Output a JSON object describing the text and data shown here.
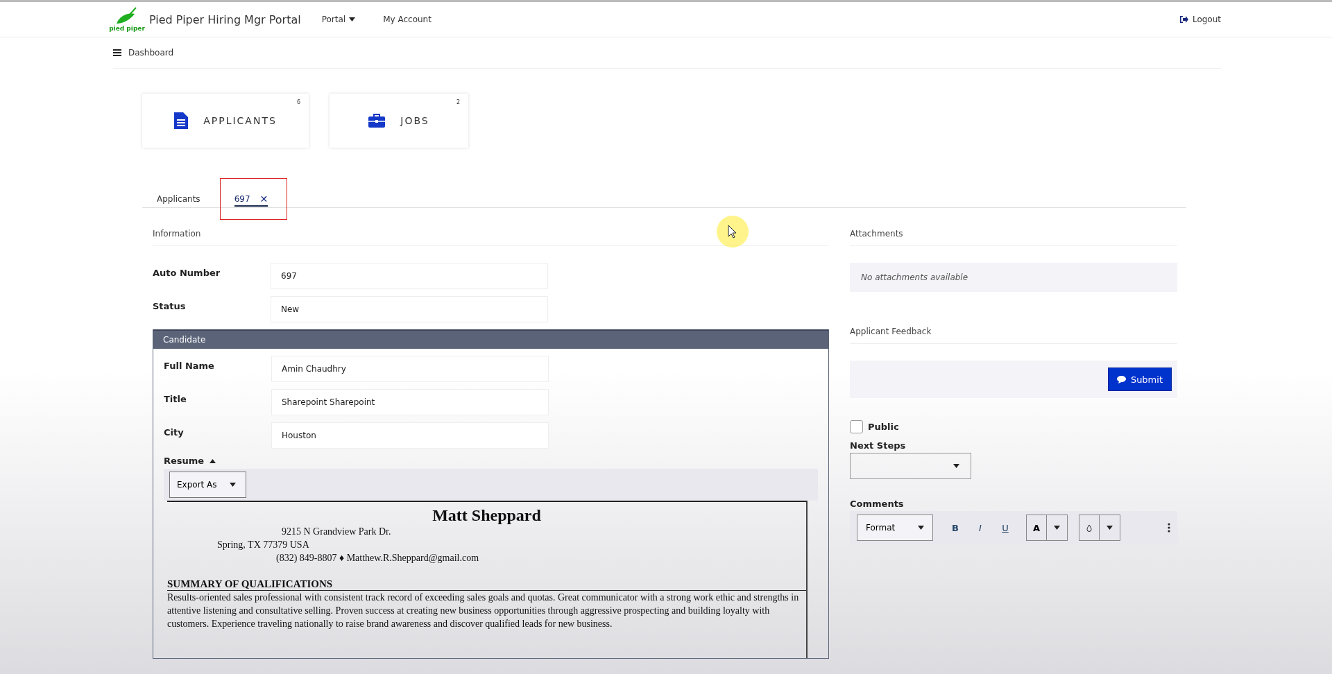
{
  "header": {
    "title": "Pied Piper Hiring Mgr Portal",
    "logo_caption": "pied piper",
    "nav": [
      {
        "label": "Portal",
        "dropdown": true
      },
      {
        "label": "My Account",
        "dropdown": false
      }
    ],
    "logout": "Logout"
  },
  "breadcrumb": "Dashboard",
  "tiles": [
    {
      "label": "APPLICANTS",
      "count": "6",
      "kind": "document"
    },
    {
      "label": "JOBS",
      "count": "2",
      "kind": "briefcase"
    }
  ],
  "tabs": [
    {
      "label": "Applicants",
      "selected": false,
      "highlighted": false
    },
    {
      "label": "697",
      "selected": true,
      "close": "✕",
      "highlighted": true
    }
  ],
  "information": {
    "heading": "Information",
    "fields": [
      {
        "label": "Auto Number",
        "value": "697"
      },
      {
        "label": "Status",
        "value": "New"
      }
    ]
  },
  "candidate": {
    "heading": "Candidate",
    "fields": [
      {
        "label": "Full Name",
        "value": "Amin Chaudhry"
      },
      {
        "label": "Title",
        "value": "Sharepoint Sharepoint"
      },
      {
        "label": "City",
        "value": "Houston"
      }
    ],
    "resume": {
      "label": "Resume",
      "expanded": true,
      "export": "Export As",
      "name": "Matt Sheppard",
      "address_lines": [
        "9215 N Grandview Park Dr.",
        "Spring, TX 77379 USA",
        "(832) 849-8807 ♦ Matthew.R.Sheppard@gmail.com"
      ],
      "section_heading": "SUMMARY OF QUALIFICATIONS",
      "summary": "Results-oriented sales professional with consistent track record of exceeding sales goals and quotas. Great communicator with a strong work ethic and strengths in attentive listening and consultative selling. Proven success at creating new business opportunities through aggressive prospecting and building loyalty with customers. Experience traveling nationally to raise brand awareness and discover qualified leads for new business."
    }
  },
  "attachments": {
    "heading": "Attachments",
    "empty": "No attachments available"
  },
  "feedback": {
    "heading": "Applicant Feedback",
    "submit": "Submit",
    "public": {
      "label": "Public",
      "checked": false
    },
    "next_steps": {
      "label": "Next Steps"
    },
    "comments": {
      "label": "Comments",
      "format": "Format",
      "bold": "B",
      "italic": "I",
      "underline": "U",
      "font_color": "A"
    }
  }
}
